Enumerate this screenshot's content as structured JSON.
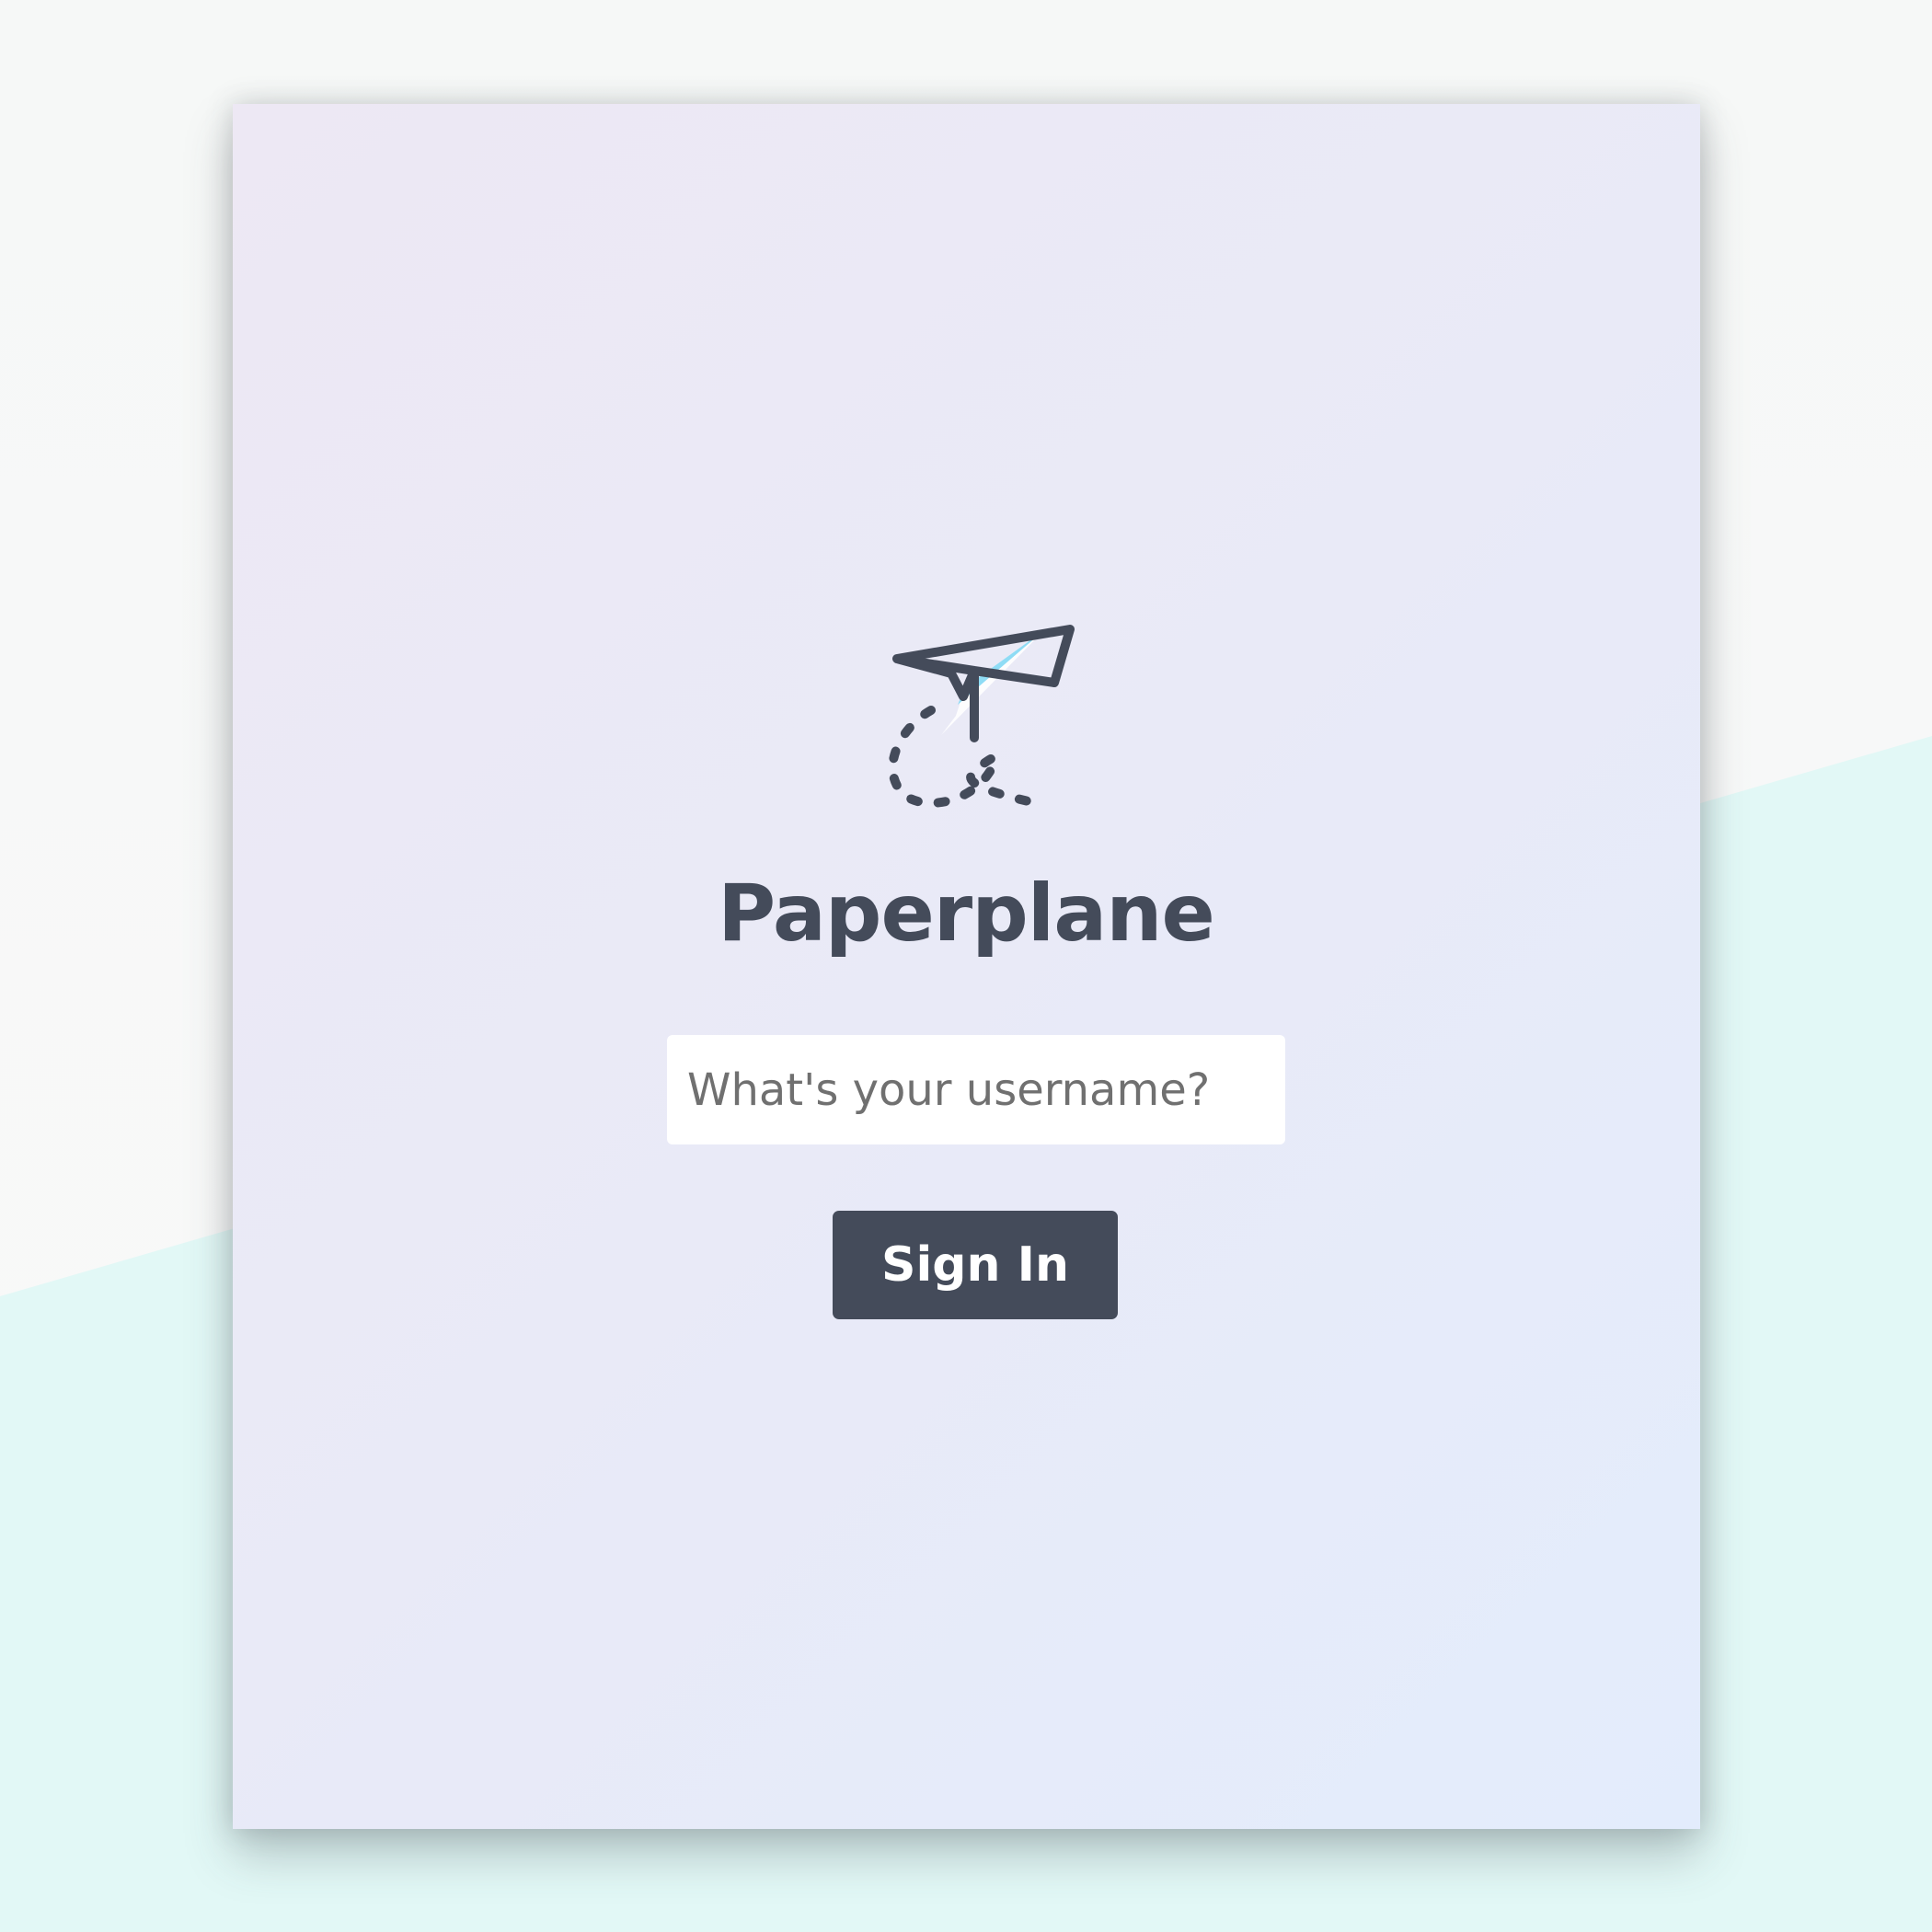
{
  "app": {
    "title": "Paperplane",
    "logo_icon": "paper-plane-icon"
  },
  "login": {
    "username_placeholder": "What's your username?",
    "username_value": "",
    "signin_label": "Sign In"
  },
  "colors": {
    "primary": "#444b5a",
    "accent": "#8fdcf5",
    "card_background": "#e9eaf7",
    "page_background_teal": "#e2f8f6"
  }
}
